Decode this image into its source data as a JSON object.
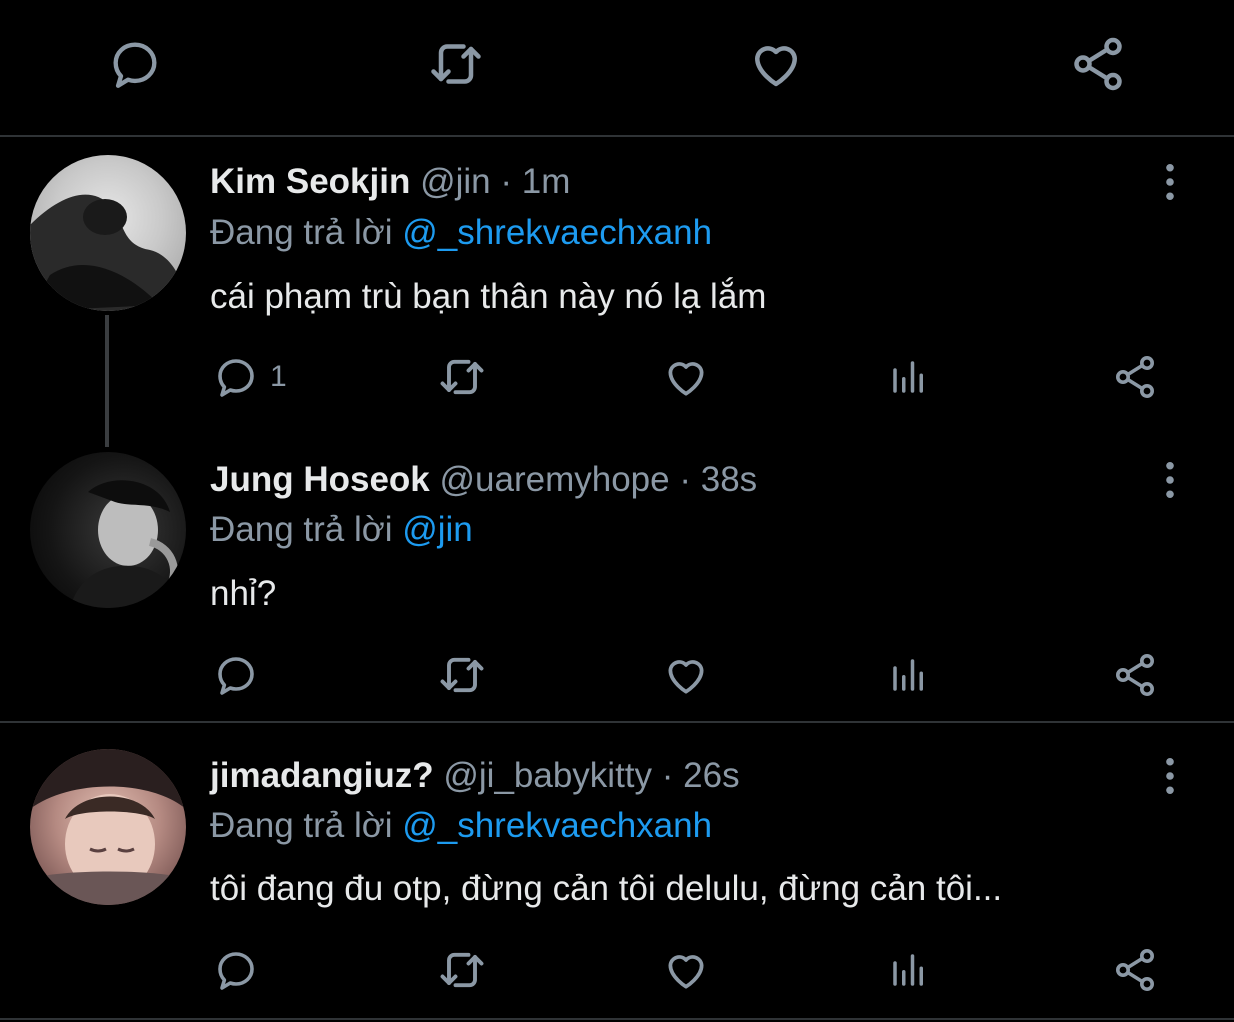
{
  "tweets": [
    {
      "name": "Kim Seokjin",
      "handle": "@jin",
      "sep": "·",
      "time": "1m",
      "reply_prefix": "Đang trả lời",
      "reply_to": "@_shrekvaechxanh",
      "text": "cái phạm trù bạn thân này nó lạ lắm",
      "reply_count": "1"
    },
    {
      "name": "Jung Hoseok",
      "handle": "@uaremyhope",
      "sep": "·",
      "time": "38s",
      "reply_prefix": "Đang trả lời",
      "reply_to": "@jin",
      "text": "nhỉ?",
      "reply_count": ""
    },
    {
      "name": "jimadangiuz?",
      "handle": "@ji_babykitty",
      "sep": "·",
      "time": "26s",
      "reply_prefix": "Đang trả lời",
      "reply_to": "@_shrekvaechxanh",
      "text": "tôi đang đu otp, đừng cản tôi delulu, đừng cản tôi...",
      "reply_count": ""
    }
  ],
  "colors": {
    "accent": "#1d9bf0",
    "muted": "#8b98a5",
    "background": "#000000",
    "divider": "#2f3336"
  },
  "icons": [
    "reply-icon",
    "retweet-icon",
    "like-icon",
    "views-icon",
    "share-icon",
    "more-icon"
  ]
}
